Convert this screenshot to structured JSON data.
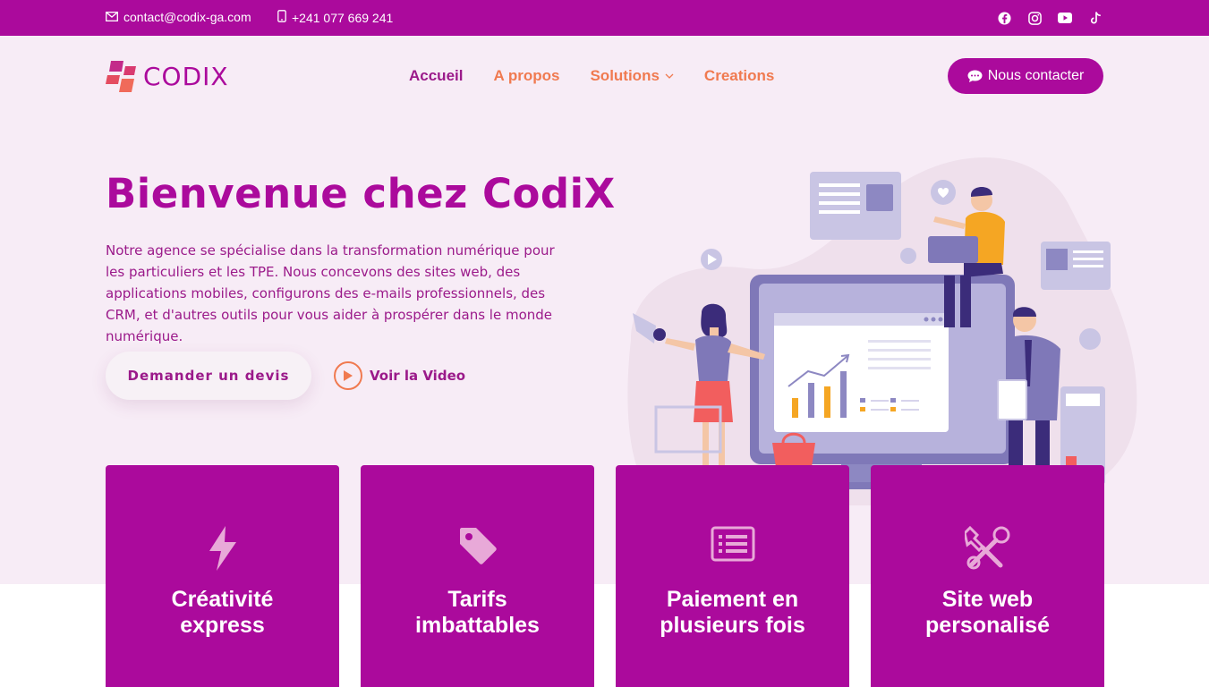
{
  "topbar": {
    "email": "contact@codix-ga.com",
    "phone": "+241 077 669 241",
    "socials": [
      "facebook-icon",
      "instagram-icon",
      "youtube-icon",
      "tiktok-icon"
    ]
  },
  "logo": {
    "text": "CODIX"
  },
  "nav": {
    "items": [
      {
        "label": "Accueil"
      },
      {
        "label": "A propos"
      },
      {
        "label": "Solutions"
      },
      {
        "label": "Creations"
      }
    ],
    "cta_label": "Nous contacter"
  },
  "hero": {
    "title": "Bienvenue chez CodiX",
    "description": "Notre agence se spécialise dans la transformation numérique pour les particuliers et les TPE. Nous concevons des sites web, des applications mobiles, configurons des e-mails professionnels, des CRM, et d'autres outils pour vous aider à prospérer dans le monde numérique.",
    "devis_label": "Demander un devis",
    "video_label": "Voir la Video"
  },
  "features": [
    {
      "title_line1": "Créativité",
      "title_line2": "express",
      "icon": "lightning-icon"
    },
    {
      "title_line1": "Tarifs",
      "title_line2": "imbattables",
      "icon": "tag-icon"
    },
    {
      "title_line1": "Paiement en",
      "title_line2": "plusieurs fois",
      "icon": "list-icon"
    },
    {
      "title_line1": "Site web",
      "title_line2": "personalisé",
      "icon": "tools-icon"
    }
  ],
  "colors": {
    "brand": "#ab0a9c",
    "accent": "#f07a50",
    "hero_bg": "#f7ecf6"
  }
}
